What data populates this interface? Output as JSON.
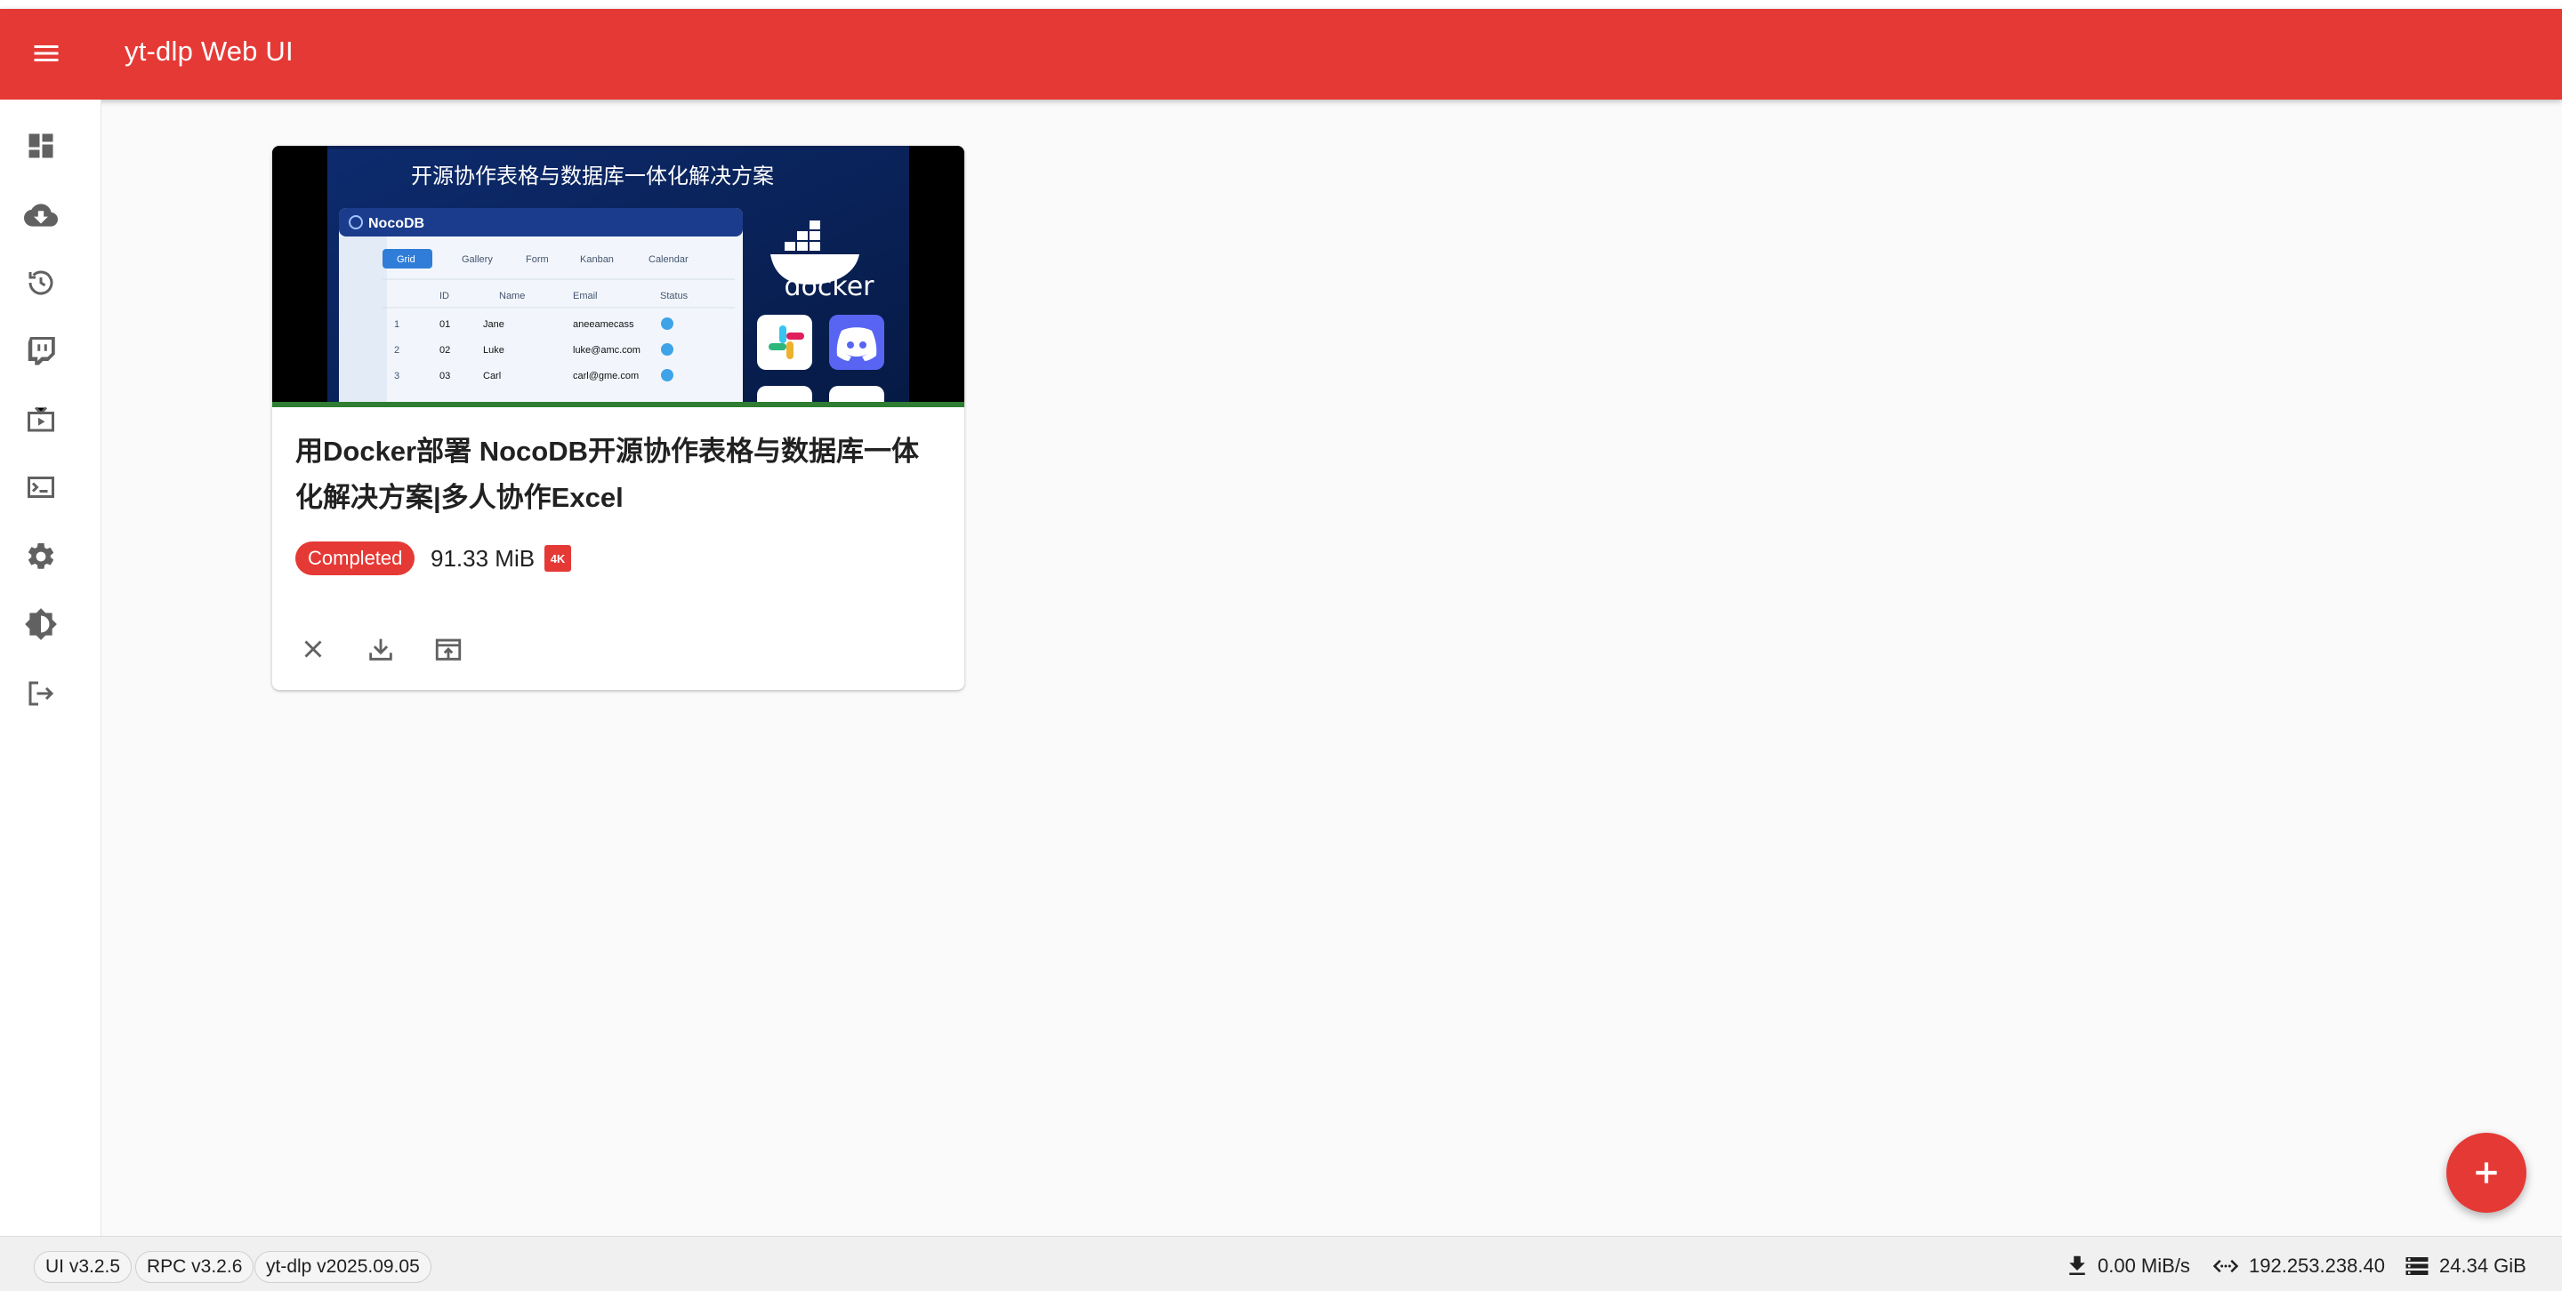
{
  "app": {
    "title": "yt-dlp Web UI"
  },
  "sidebar": {
    "items": [
      {
        "name": "dashboard",
        "icon": "dashboard-icon"
      },
      {
        "name": "downloads",
        "icon": "cloud-download-icon"
      },
      {
        "name": "history",
        "icon": "history-icon"
      },
      {
        "name": "twitch",
        "icon": "twitch-icon"
      },
      {
        "name": "livestream",
        "icon": "live-tv-icon"
      },
      {
        "name": "terminal",
        "icon": "terminal-icon"
      },
      {
        "name": "settings",
        "icon": "gear-icon"
      },
      {
        "name": "theme",
        "icon": "brightness-icon"
      },
      {
        "name": "logout",
        "icon": "logout-icon"
      }
    ]
  },
  "thumbnail": {
    "headline": "开源协作表格与数据库一体化解决方案",
    "app_name": "NocoDB",
    "tabs": [
      "Grid",
      "Gallery",
      "Form",
      "Kanban",
      "Calendar"
    ],
    "columns": [
      "ID",
      "Name",
      "Email",
      "Status"
    ],
    "rows": [
      {
        "n": "1",
        "id": "01",
        "name": "Jane",
        "email": "aneeamecass"
      },
      {
        "n": "2",
        "id": "02",
        "name": "Luke",
        "email": "luke@amc.com"
      },
      {
        "n": "3",
        "id": "03",
        "name": "Carl",
        "email": "carl@gme.com"
      }
    ],
    "docker_label": "docker"
  },
  "card": {
    "title": "用Docker部署 NocoDB开源协作表格与数据库一体化解决方案|多人协作Excel",
    "status": "Completed",
    "size": "91.33 MiB",
    "quality_badge": "4K",
    "progress": 1.0
  },
  "footer": {
    "versions": [
      "UI v3.2.5",
      "RPC v3.2.6",
      "yt-dlp v2025.09.05"
    ],
    "download_speed": "0.00 MiB/s",
    "ip": "192.253.238.40",
    "disk": "24.34 GiB"
  },
  "colors": {
    "primary": "#e53935",
    "progress": "#2e7d32",
    "background": "#fafafa"
  }
}
